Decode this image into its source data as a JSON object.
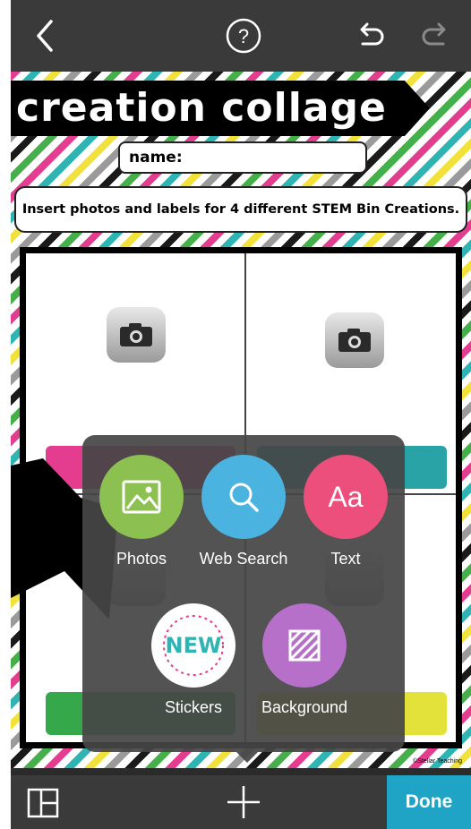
{
  "toolbar": {
    "back_icon": "chevron-left-icon",
    "help_icon": "question-circle-icon",
    "undo_icon": "undo-icon",
    "redo_icon": "redo-icon"
  },
  "worksheet": {
    "title": "creation collage",
    "name_label": "name:",
    "instructions": "Insert photos and labels for 4 different STEM Bin Creations.",
    "copyright": "©Stellar Teaching"
  },
  "menu": {
    "options": [
      {
        "label": "Photos",
        "icon": "image-icon",
        "color": "#8cc152"
      },
      {
        "label": "Web Search",
        "icon": "search-icon",
        "color": "#4bb3e0"
      },
      {
        "label": "Text",
        "icon": "text-icon",
        "color": "#ec4f7b"
      },
      {
        "label": "Stickers",
        "icon": "new-sticker-icon",
        "color": "#ffffff"
      },
      {
        "label": "Background",
        "icon": "background-pattern-icon",
        "color": "#b670c9"
      }
    ],
    "sticker_text": "NEW",
    "text_icon_glyph": "Aa"
  },
  "bottombar": {
    "layout_icon": "layout-icon",
    "add_icon": "plus-icon",
    "done_label": "Done"
  },
  "colors": {
    "accent": "#1fa4c6",
    "label_pink": "#e43c8f",
    "label_teal": "#2aa3a6",
    "label_green": "#34a84a",
    "label_yellow": "#e3e23a"
  }
}
